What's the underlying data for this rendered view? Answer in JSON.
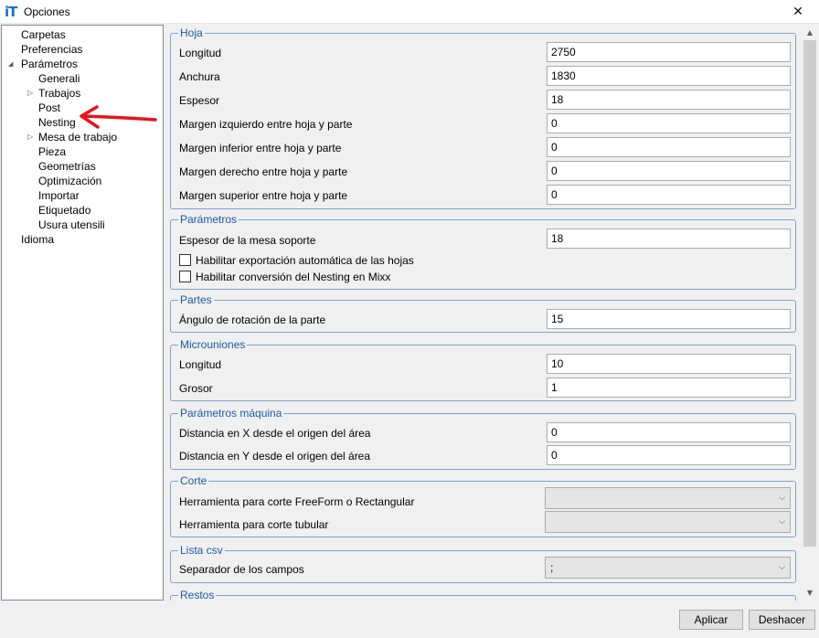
{
  "window": {
    "title": "Opciones",
    "app_icon": "iT",
    "close_glyph": "✕"
  },
  "nav": {
    "items": [
      {
        "label": "Carpetas"
      },
      {
        "label": "Preferencias"
      },
      {
        "label": "Parámetros",
        "expanded": true
      },
      {
        "label": "Generali"
      },
      {
        "label": "Trabajos",
        "expandable": true
      },
      {
        "label": "Post"
      },
      {
        "label": "Nesting"
      },
      {
        "label": "Mesa de trabajo",
        "expandable": true
      },
      {
        "label": "Pieza"
      },
      {
        "label": "Geometrías"
      },
      {
        "label": "Optimización"
      },
      {
        "label": "Importar"
      },
      {
        "label": "Etiquetado"
      },
      {
        "label": "Usura utensili"
      },
      {
        "label": "Idioma"
      }
    ],
    "expanded_glyph": "◢",
    "collapsed_glyph": "▷"
  },
  "annotation": {
    "color": "#e8141c"
  },
  "sections": {
    "hoja": {
      "title": "Hoja",
      "rows": [
        {
          "label": "Longitud",
          "value": "2750"
        },
        {
          "label": "Anchura",
          "value": "1830"
        },
        {
          "label": "Espesor",
          "value": "18"
        },
        {
          "label": "Margen izquierdo entre hoja y parte",
          "value": "0"
        },
        {
          "label": "Margen inferior entre hoja y parte",
          "value": "0"
        },
        {
          "label": "Margen derecho entre hoja y parte",
          "value": "0"
        },
        {
          "label": "Margen superior entre hoja y parte",
          "value": "0"
        }
      ]
    },
    "parametros": {
      "title": "Parámetros",
      "rows": [
        {
          "label": "Espesor de la mesa soporte",
          "value": "18"
        }
      ],
      "checks": [
        {
          "label": "Habilitar exportación automática de las hojas",
          "checked": false
        },
        {
          "label": "Habilitar conversión del Nesting en Mixx",
          "checked": false
        }
      ]
    },
    "partes": {
      "title": "Partes",
      "rows": [
        {
          "label": "Ángulo de rotación de la parte",
          "value": "15"
        }
      ]
    },
    "microuniones": {
      "title": "Microuniones",
      "rows": [
        {
          "label": "Longitud",
          "value": "10"
        },
        {
          "label": "Grosor",
          "value": "1"
        }
      ]
    },
    "maquina": {
      "title": "Parámetros máquina",
      "rows": [
        {
          "label": "Distancia en X desde el origen del área",
          "value": "0"
        },
        {
          "label": "Distancia en Y desde el origen del área",
          "value": "0"
        }
      ]
    },
    "corte": {
      "title": "Corte",
      "rows": [
        {
          "label": "Herramienta para corte FreeForm o Rectangular",
          "value": ""
        },
        {
          "label": "Herramienta para corte tubular",
          "value": ""
        }
      ]
    },
    "lista_csv": {
      "title": "Lista csv",
      "rows": [
        {
          "label": "Separador de los campos",
          "value": ";"
        }
      ]
    },
    "restos": {
      "title": "Restos"
    }
  },
  "scrollbar": {
    "up_glyph": "▲",
    "down_glyph": "▼"
  },
  "buttons": {
    "apply": "Aplicar",
    "undo": "Deshacer"
  }
}
